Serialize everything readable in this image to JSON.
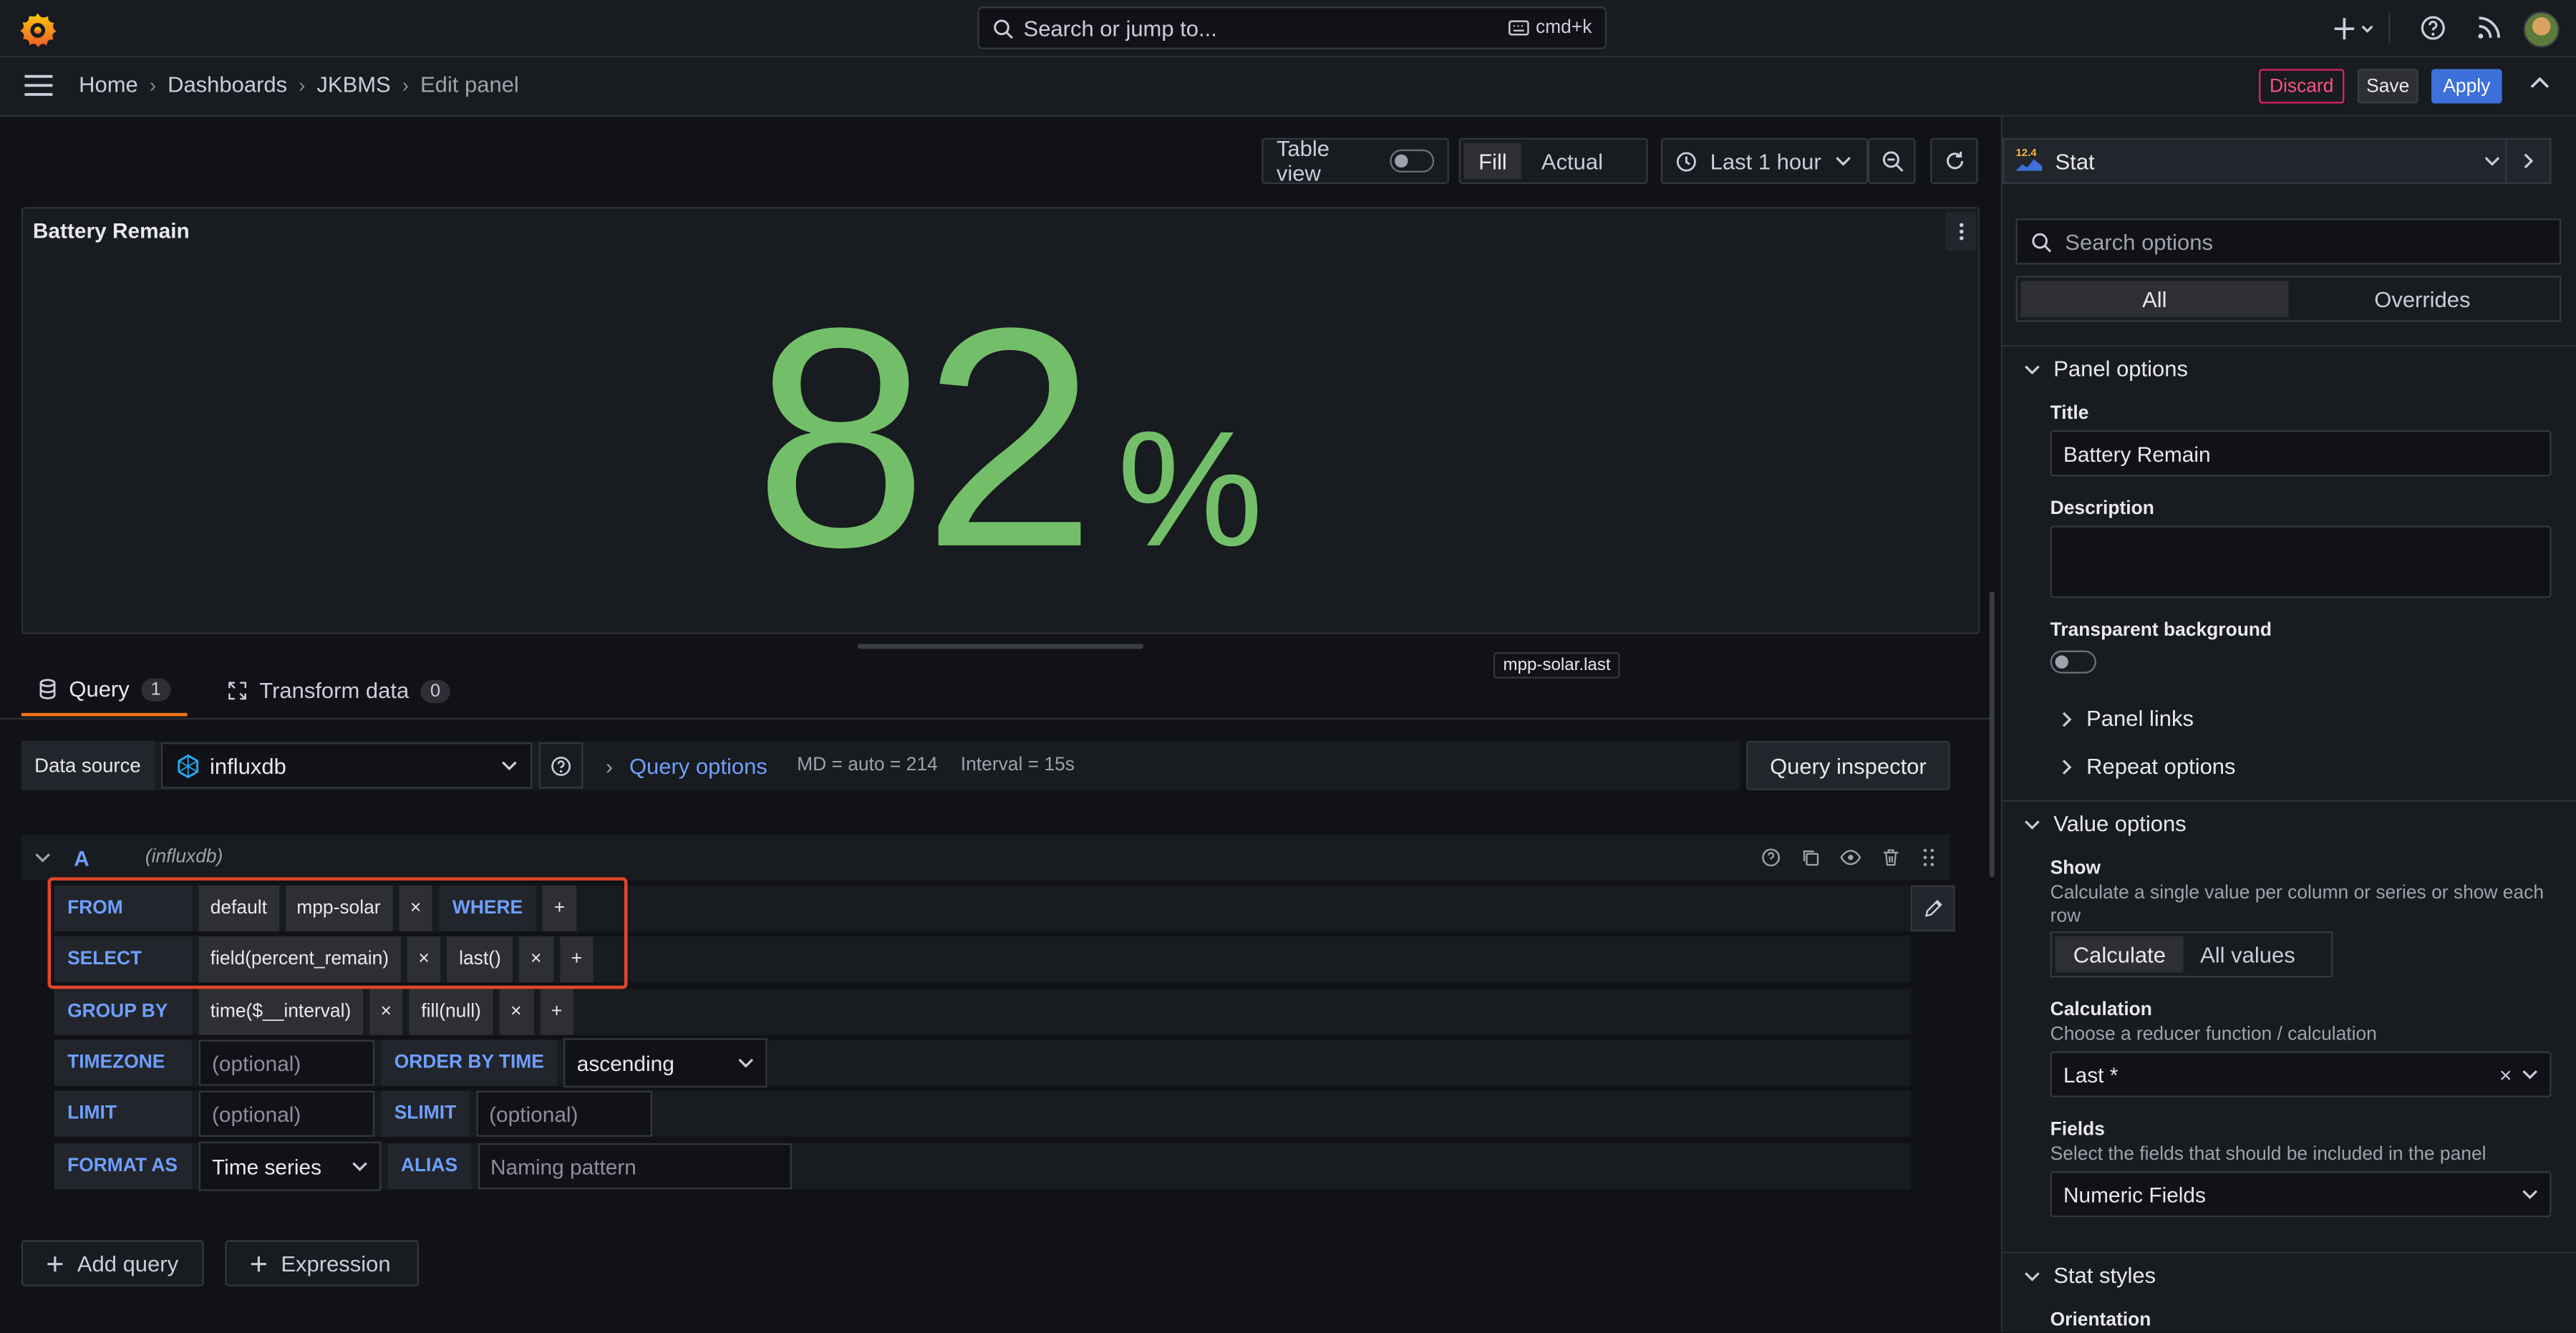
{
  "topbar": {
    "search_placeholder": "Search or jump to...",
    "search_shortcut": "cmd+k"
  },
  "breadcrumb": {
    "items": [
      "Home",
      "Dashboards",
      "JKBMS"
    ],
    "current": "Edit panel"
  },
  "actions": {
    "discard": "Discard",
    "save": "Save",
    "apply": "Apply"
  },
  "panel_toolbar": {
    "table_view": "Table view",
    "fill": "Fill",
    "actual": "Actual",
    "time_range": "Last 1 hour"
  },
  "panel": {
    "title": "Battery Remain",
    "value": "82",
    "unit": "%",
    "value_color": "#73bf69",
    "tooltip": "mpp-solar.last"
  },
  "tabs": {
    "query": {
      "label": "Query",
      "count": "1"
    },
    "transform": {
      "label": "Transform data",
      "count": "0"
    }
  },
  "datasource": {
    "label": "Data source",
    "value": "influxdb",
    "query_options": "Query options",
    "md": "MD = auto = 214",
    "interval": "Interval = 15s",
    "inspector": "Query inspector"
  },
  "query": {
    "ref": "A",
    "source_hint": "(influxdb)",
    "from_kw": "FROM",
    "from_policy": "default",
    "from_measurement": "mpp-solar",
    "where_kw": "WHERE",
    "select_kw": "SELECT",
    "select_field": "field(percent_remain)",
    "select_fn": "last()",
    "groupby_kw": "GROUP BY",
    "groupby_time": "time($__interval)",
    "groupby_fill": "fill(null)",
    "timezone_kw": "TIMEZONE",
    "timezone_placeholder": "(optional)",
    "orderby_kw": "ORDER BY TIME",
    "orderby_value": "ascending",
    "limit_kw": "LIMIT",
    "limit_placeholder": "(optional)",
    "slimit_kw": "SLIMIT",
    "slimit_placeholder": "(optional)",
    "format_kw": "FORMAT AS",
    "format_value": "Time series",
    "alias_kw": "ALIAS",
    "alias_placeholder": "Naming pattern",
    "plus": "+",
    "close": "×"
  },
  "bottom_buttons": {
    "add_query": "Add query",
    "expression": "Expression"
  },
  "sidebar": {
    "viz_version": "12.4",
    "viz": "Stat",
    "search_placeholder": "Search options",
    "tab_all": "All",
    "tab_overrides": "Overrides",
    "panel_options": "Panel options",
    "title_label": "Title",
    "title_value": "Battery Remain",
    "description_label": "Description",
    "transparent_label": "Transparent background",
    "panel_links": "Panel links",
    "repeat_options": "Repeat options",
    "value_options": "Value options",
    "show_label": "Show",
    "show_desc": "Calculate a single value per column or series or show each row",
    "show_calculate": "Calculate",
    "show_all": "All values",
    "calc_label": "Calculation",
    "calc_desc": "Choose a reducer function / calculation",
    "calc_value": "Last *",
    "fields_label": "Fields",
    "fields_desc": "Select the fields that should be included in the panel",
    "fields_value": "Numeric Fields",
    "stat_styles": "Stat styles",
    "orientation_label": "Orientation"
  }
}
